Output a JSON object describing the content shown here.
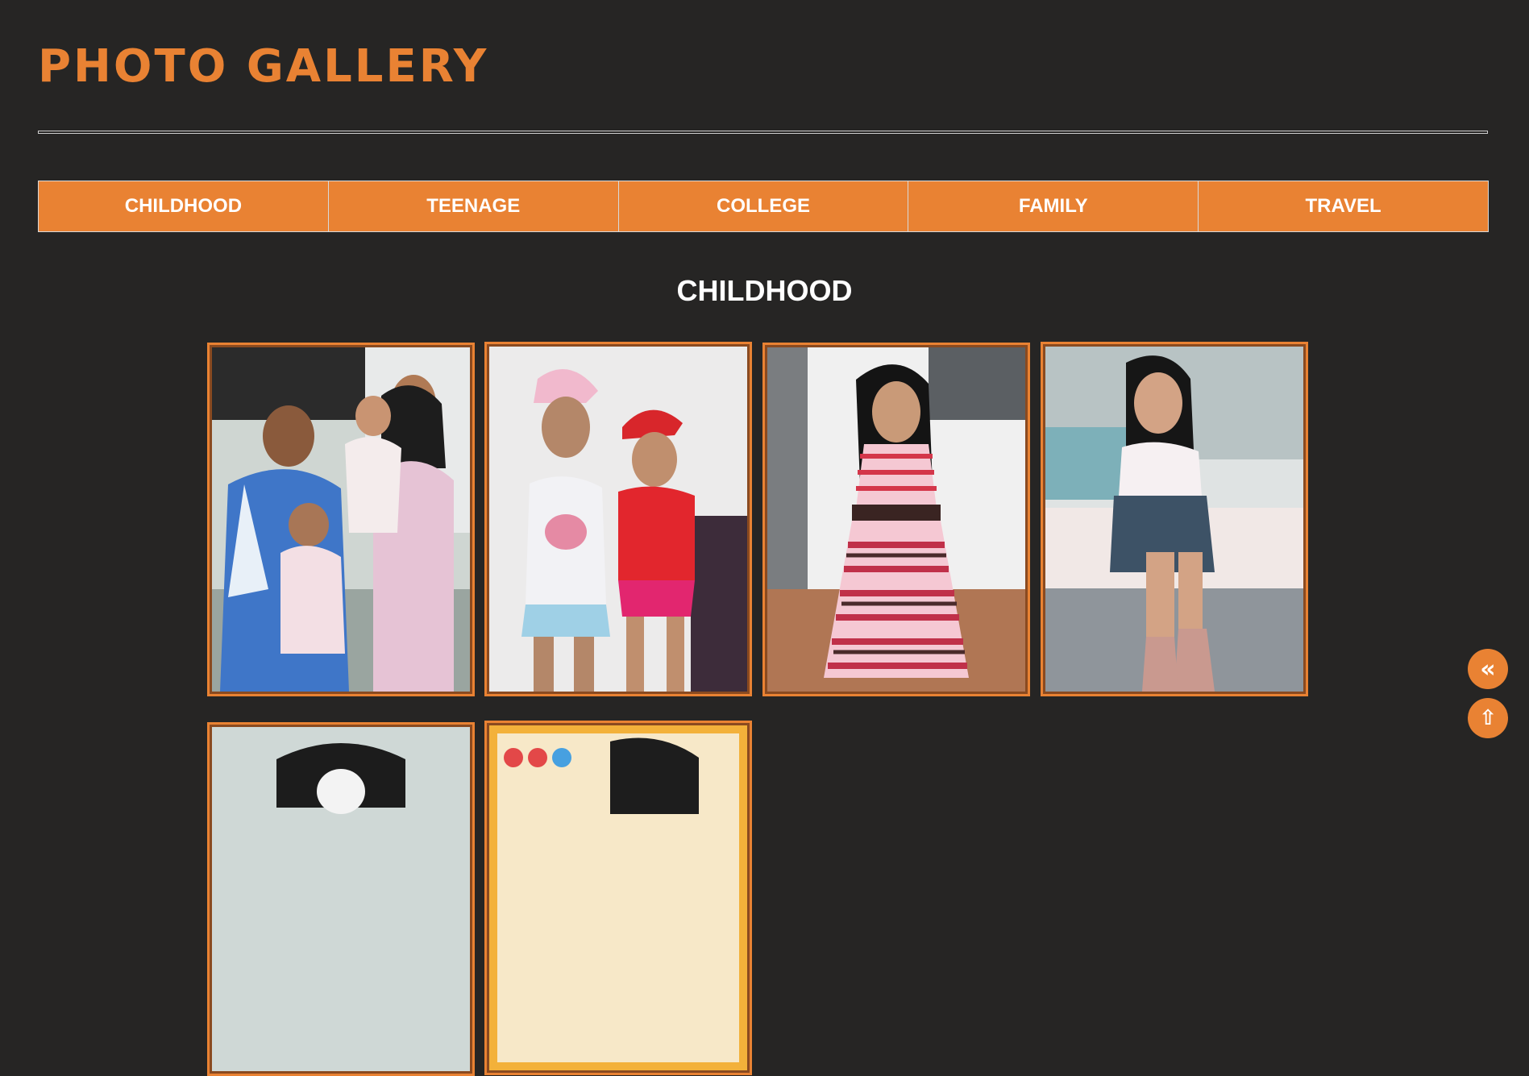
{
  "header": {
    "title": "PHOTO GALLERY"
  },
  "nav": {
    "items": [
      {
        "label": "CHILDHOOD"
      },
      {
        "label": "TEENAGE"
      },
      {
        "label": "COLLEGE"
      },
      {
        "label": "FAMILY"
      },
      {
        "label": "TRAVEL"
      }
    ]
  },
  "section": {
    "title": "CHILDHOOD"
  },
  "photos": [
    {
      "subject": "family portrait"
    },
    {
      "subject": "two girls posing"
    },
    {
      "subject": "girl in striped dress"
    },
    {
      "subject": "girl sitting on bed"
    },
    {
      "subject": "photo"
    },
    {
      "subject": "photo"
    }
  ],
  "buttons": {
    "back": "«",
    "top": "⇧"
  },
  "colors": {
    "accent": "#e98233",
    "background": "#262524"
  }
}
